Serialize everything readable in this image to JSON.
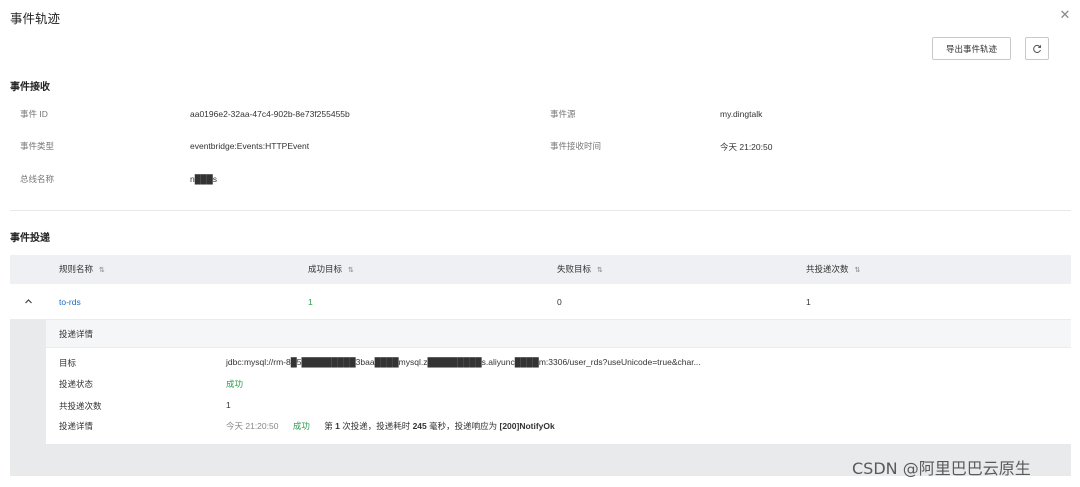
{
  "dialog": {
    "title": "事件轨迹"
  },
  "toolbar": {
    "export_label": "导出事件轨迹",
    "refresh_icon": "refresh-icon",
    "close_icon": "close-icon"
  },
  "receive": {
    "heading": "事件接收",
    "fields": [
      {
        "label": "事件 ID",
        "value": "aa0196e2-32aa-47c4-902b-8e73f255455b"
      },
      {
        "label": "事件源",
        "value": "my.dingtalk"
      },
      {
        "label": "事件类型",
        "value": "eventbridge:Events:HTTPEvent"
      },
      {
        "label": "事件接收时间",
        "value": "今天 21:20:50"
      },
      {
        "label": "总线名称",
        "value": "n███s"
      }
    ]
  },
  "delivery": {
    "heading": "事件投递",
    "columns": [
      "规则名称",
      "成功目标",
      "失败目标",
      "共投递次数"
    ],
    "sort_glyph": "⇅",
    "rows": [
      {
        "rule": "to-rds",
        "success": "1",
        "failed": "0",
        "total": "1"
      }
    ],
    "detail": {
      "heading": "投递详情",
      "target_label": "目标",
      "target_value": "jdbc:mysql://rm-8█5█████████3baa████mysql.z█████████s.aliyunc████m:3306/user_rds?useUnicode=true&char...",
      "status_label": "投递状态",
      "status_value": "成功",
      "count_label": "共投递次数",
      "count_value": "1",
      "info_label": "投递详情",
      "info_time": "今天 21:20:50",
      "info_status": "成功",
      "info_text_1": "第 ",
      "info_num": "1",
      "info_text_2": " 次投递，投递耗时 ",
      "info_ms": "245",
      "info_text_3": " 毫秒，投递响应为 ",
      "info_resp": "[200]NotifyOk"
    }
  },
  "watermark": "CSDN @阿里巴巴云原生"
}
